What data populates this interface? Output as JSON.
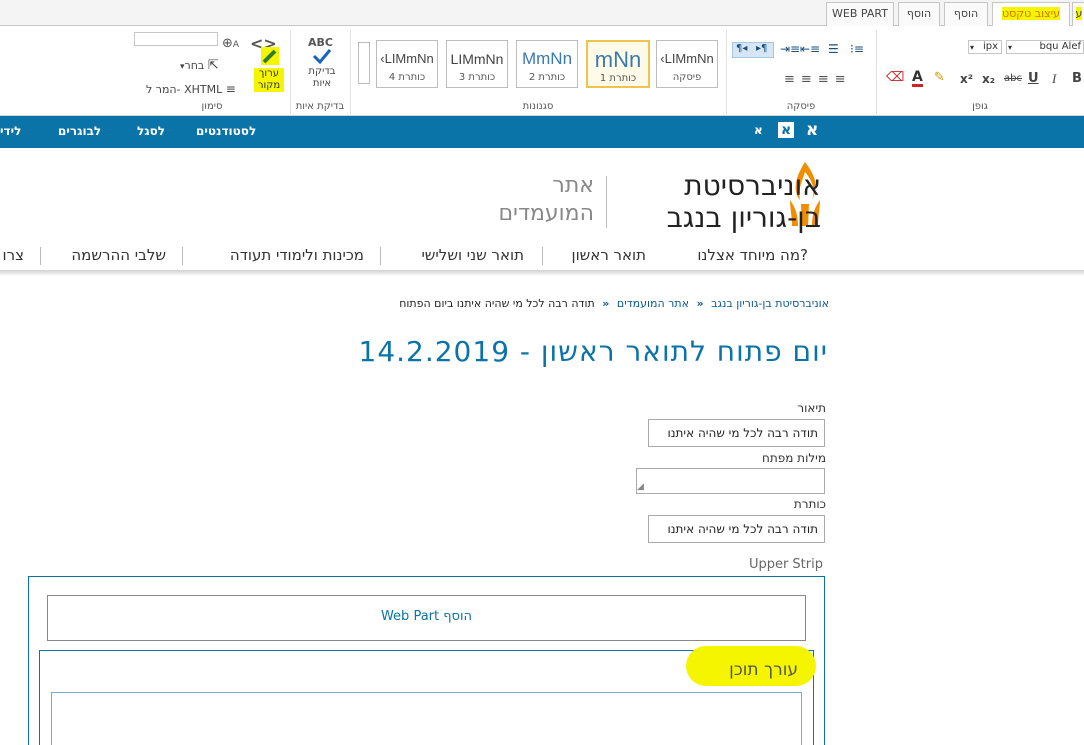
{
  "ribbon_tabs": [
    {
      "label": "WEB PART"
    },
    {
      "label": "הוסף"
    },
    {
      "label": "הוסף"
    },
    {
      "label": "עיצוב טקסט"
    },
    {
      "label": "ע"
    }
  ],
  "ribbon": {
    "markup_group": {
      "label": "סימון",
      "select_label": "בחר",
      "convert_label": "המר ל- XHTML",
      "edit_source_label": "ערוך מקור"
    },
    "spelling_group": {
      "label": "בדיקת איות",
      "abc": "ABC",
      "spelling_button": "בדיקת איות"
    },
    "styles_group": {
      "label": "סגנונות",
      "styles": [
        {
          "sample": "‹LIMmNn",
          "name": "כותרת 4"
        },
        {
          "sample": "LIMmNn",
          "name": "כותרת 3"
        },
        {
          "sample": "MmNn",
          "name": "כותרת 2"
        },
        {
          "sample": "mNn",
          "name": "כותרת 1"
        },
        {
          "sample": "‹LIMmNn",
          "name": "פיסקה"
        }
      ]
    },
    "paragraph_group": {
      "label": "פיסקה"
    },
    "font_group": {
      "label": "גופן",
      "font_name": "bqu Alef",
      "font_size": "ipx",
      "buttons": {
        "bold": "B",
        "italic": "I",
        "underline": "U",
        "strike": "abc",
        "subscript": "x₂",
        "superscript": "x²",
        "font_color": "A"
      }
    }
  },
  "topbar": {
    "font_sizes": [
      "א",
      "א",
      "א"
    ],
    "links": [
      "לסטודנטים",
      "לסגל",
      "לבוגרים",
      "לידי"
    ]
  },
  "header": {
    "logo_main": [
      "אוניברסיטת",
      "בן-גוריון בנגב"
    ],
    "logo_sub": [
      "אתר",
      "המועמדים"
    ]
  },
  "nav": [
    "מה מיוחד אצלנו?",
    "תואר ראשון",
    "תואר שני ושלישי",
    "מכינות ולימודי תעודה",
    "שלבי ההרשמה",
    "צרו"
  ],
  "breadcrumb": [
    "אוניברסיטת בן-גוריון בנגב",
    "אתר המועמדים",
    "תודה רבה לכל מי שהיה איתנו ביום הפתוח"
  ],
  "page_title": "יום פתוח לתואר ראשון - 14.2.2019",
  "form": {
    "description_label": "תיאור",
    "description_value": "תודה רבה לכל מי שהיה איתנו",
    "keywords_label": "מילות מפתח",
    "keywords_value": "",
    "title_label": "כותרת",
    "title_value": "תודה רבה לכל מי שהיה איתנו"
  },
  "upper_strip": {
    "label": "Upper Strip",
    "add_webpart": "הוסף Web Part",
    "content_editor_title": "עורך תוכן"
  },
  "colors": {
    "brand_blue": "#0a73a8",
    "highlight": "#f5f500",
    "active_tab": "#e07000",
    "logo_orange": "#f28c00"
  }
}
